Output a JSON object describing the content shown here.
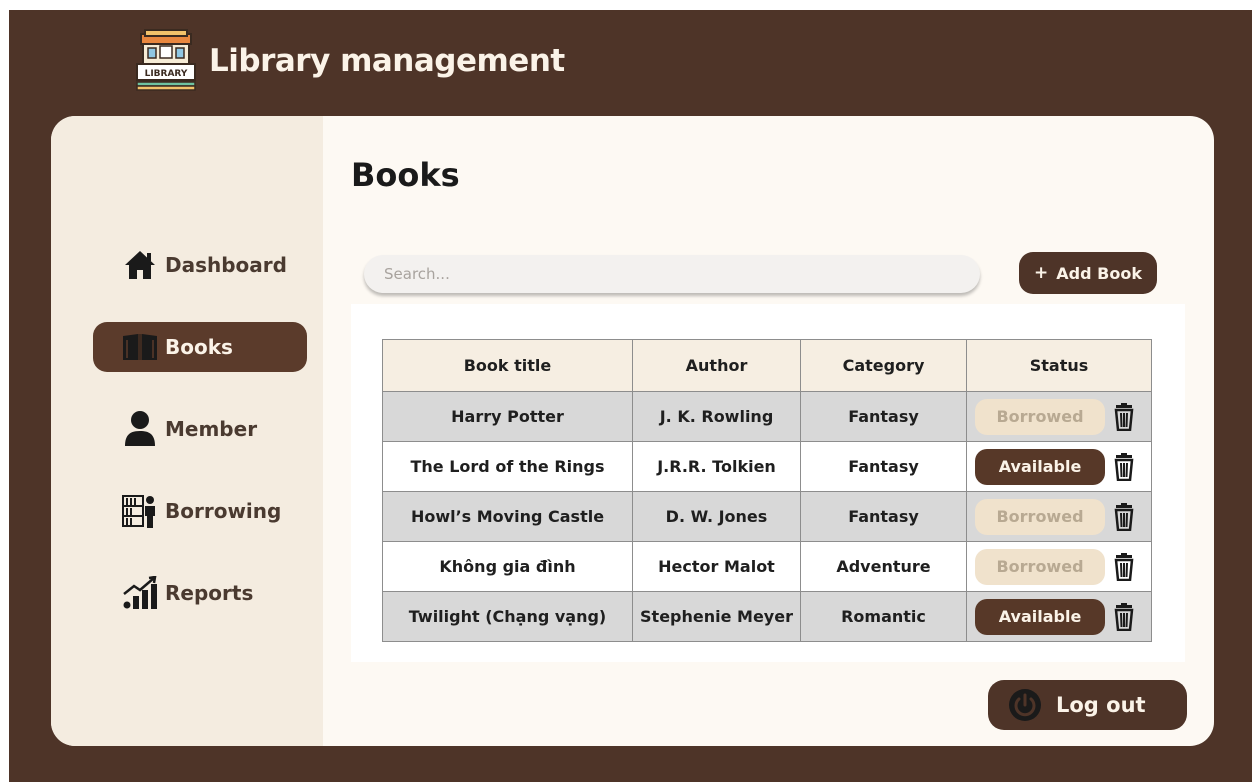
{
  "app": {
    "title": "Library management",
    "logo_text": "LIBRARY"
  },
  "sidebar": {
    "items": [
      {
        "label": "Dashboard",
        "icon": "home-icon",
        "active": false
      },
      {
        "label": "Books",
        "icon": "book-icon",
        "active": true
      },
      {
        "label": "Member",
        "icon": "user-icon",
        "active": false
      },
      {
        "label": "Borrowing",
        "icon": "borrowing-icon",
        "active": false
      },
      {
        "label": "Reports",
        "icon": "chart-icon",
        "active": false
      }
    ]
  },
  "main": {
    "title": "Books",
    "search": {
      "placeholder": "Search...",
      "value": ""
    },
    "add_button": {
      "icon": "+",
      "label": "Add Book"
    },
    "table": {
      "headers": [
        "Book title",
        "Author",
        "Category",
        "Status"
      ],
      "rows": [
        {
          "title": "Harry Potter",
          "author": "J. K. Rowling",
          "category": "Fantasy",
          "status": "Borrowed"
        },
        {
          "title": "The Lord of the Rings",
          "author": "J.R.R. Tolkien",
          "category": "Fantasy",
          "status": "Available"
        },
        {
          "title": "Howl’s Moving Castle",
          "author": "D. W. Jones",
          "category": "Fantasy",
          "status": "Borrowed"
        },
        {
          "title": "Không gia đình",
          "author": "Hector Malot",
          "category": "Adventure",
          "status": "Borrowed"
        },
        {
          "title": "Twilight (Chạng vạng)",
          "author": "Stephenie Meyer",
          "category": "Romantic",
          "status": "Available"
        }
      ]
    },
    "logout": {
      "label": "Log out",
      "icon": "power-icon"
    }
  },
  "colors": {
    "frame": "#4e3428",
    "sidebar": "#f4ece0",
    "content": "#fdf9f3",
    "accent": "#5b3b2b",
    "borrowed_pill": "#f0e2cc",
    "row_shade": "#d8d8d8",
    "header_bg": "#f6eee2"
  }
}
